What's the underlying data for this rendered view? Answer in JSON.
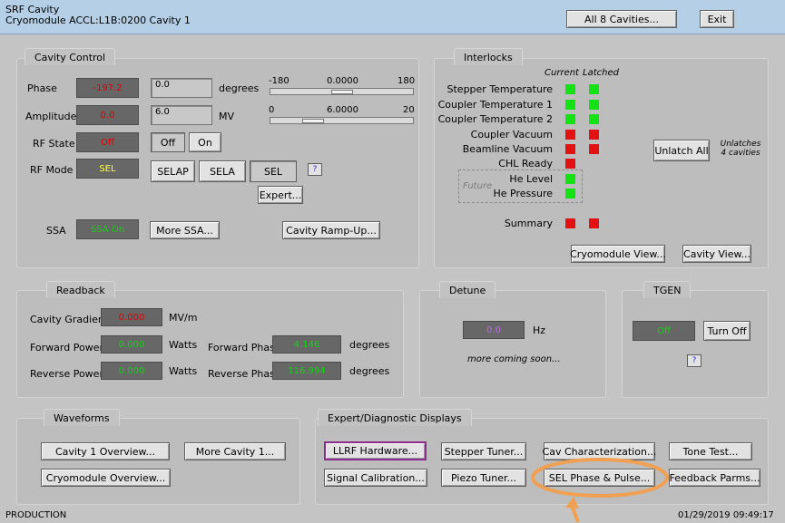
{
  "header": {
    "title_line1": "SRF Cavity",
    "title_line2": "Cryomodule ACCL:L1B:0200 Cavity 1",
    "all_cavities_label": "All 8 Cavities...",
    "exit_label": "Exit"
  },
  "cavity_control": {
    "tab": "Cavity Control",
    "phase": {
      "label": "Phase",
      "readback": "-197.2",
      "setpoint": "0.0",
      "unit": "degrees",
      "slider_min": "-180",
      "slider_max": "180",
      "slider_value": "0.0000",
      "slider_fraction": 0.5
    },
    "amplitude": {
      "label": "Amplitude",
      "readback": "0.0",
      "setpoint": "6.0",
      "unit": "MV",
      "slider_min": "0",
      "slider_max": "20",
      "slider_value": "6.0000",
      "slider_fraction": 0.3
    },
    "rf_state": {
      "label": "RF State",
      "readback": "Off",
      "off_label": "Off",
      "on_label": "On"
    },
    "rf_mode": {
      "label": "RF Mode",
      "readback": "SEL",
      "selap_label": "SELAP",
      "sela_label": "SELA",
      "sel_label": "SEL",
      "help_label": "?",
      "expert_label": "Expert..."
    },
    "ssa": {
      "label": "SSA",
      "readback": "SSA On",
      "more_label": "More SSA..."
    },
    "ramp_up_label": "Cavity Ramp-Up..."
  },
  "interlocks": {
    "tab": "Interlocks",
    "col_current": "Current",
    "col_latched": "Latched",
    "items": [
      {
        "label": "Stepper Temperature",
        "current": "green",
        "latched": "green"
      },
      {
        "label": "Coupler Temperature 1",
        "current": "green",
        "latched": "green"
      },
      {
        "label": "Coupler Temperature 2",
        "current": "green",
        "latched": "green"
      },
      {
        "label": "Coupler Vacuum",
        "current": "red",
        "latched": "red"
      },
      {
        "label": "Beamline Vacuum",
        "current": "red",
        "latched": "red"
      },
      {
        "label": "CHL Ready",
        "current": "red"
      }
    ],
    "future_label": "Future",
    "future_items": [
      {
        "label": "He Level",
        "current": "green"
      },
      {
        "label": "He Pressure",
        "current": "green"
      }
    ],
    "summary": {
      "label": "Summary",
      "current": "red",
      "latched": "red"
    },
    "unlatch_label": "Unlatch All",
    "unlatch_note_1": "Unlatches",
    "unlatch_note_2": "4 cavities",
    "cryomodule_view_label": "Cryomodule View...",
    "cavity_view_label": "Cavity View..."
  },
  "readback": {
    "tab": "Readback",
    "gradient": {
      "label": "Cavity Gradient",
      "value": "0.000",
      "unit": "MV/m"
    },
    "forward_power": {
      "label": "Forward Power",
      "value": "0.000",
      "unit": "Watts"
    },
    "reverse_power": {
      "label": "Reverse Power",
      "value": "0.000",
      "unit": "Watts"
    },
    "forward_phase": {
      "label": "Forward Phase",
      "value": "4.146",
      "unit": "degrees"
    },
    "reverse_phase": {
      "label": "Reverse Phase",
      "value": "116.994",
      "unit": "degrees"
    }
  },
  "detune": {
    "tab": "Detune",
    "value": "0.0",
    "unit": "Hz",
    "note": "more coming soon..."
  },
  "tgen": {
    "tab": "TGEN",
    "readback": "Off",
    "turn_off_label": "Turn Off",
    "help_label": "?"
  },
  "waveforms": {
    "tab": "Waveforms",
    "cavity_overview_label": "Cavity 1 Overview...",
    "more_cavity_label": "More Cavity 1...",
    "cryomodule_overview_label": "Cryomodule Overview..."
  },
  "expert": {
    "tab": "Expert/Diagnostic Displays",
    "llrf_label": "LLRF Hardware...",
    "stepper_label": "Stepper Tuner...",
    "cav_char_label": "Cav Characterization...",
    "tone_test_label": "Tone Test...",
    "signal_cal_label": "Signal Calibration...",
    "piezo_label": "Piezo Tuner...",
    "sel_phase_label": "SEL Phase & Pulse...",
    "feedback_label": "Feedback Parms..."
  },
  "footer": {
    "mode": "PRODUCTION",
    "timestamp": "01/29/2019 09:49:17"
  },
  "colors": {
    "header": "#b4cfe6",
    "indicator_green": "#14e214",
    "indicator_red": "#e21212",
    "highlight_orange": "#f0a052"
  }
}
